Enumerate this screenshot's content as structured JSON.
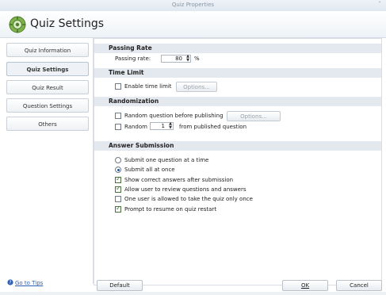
{
  "window": {
    "title": "Quiz Properties",
    "chevron": "˅"
  },
  "header": {
    "title": "Quiz Settings",
    "icon": "gear-settings-icon"
  },
  "sidebar": {
    "items": [
      {
        "label": "Quiz Information"
      },
      {
        "label": "Quiz Settings",
        "active": true
      },
      {
        "label": "Quiz Result"
      },
      {
        "label": "Question Settings"
      },
      {
        "label": "Others"
      }
    ],
    "tips_link": "Go to Tips"
  },
  "passing_rate": {
    "header": "Passing Rate",
    "label": "Passing rate:",
    "value": "80",
    "unit": "%"
  },
  "time_limit": {
    "header": "Time Limit",
    "enable_label": "Enable time limit",
    "enabled": false,
    "options_label": "Options..."
  },
  "randomization": {
    "header": "Randomization",
    "random_before_label": "Random question before publishing",
    "random_before_checked": false,
    "options_label": "Options...",
    "random_label": "Random",
    "random_count": "1",
    "random_suffix": "from published question",
    "random_checked": false
  },
  "answer_submission": {
    "header": "Answer Submission",
    "radios": [
      {
        "label": "Submit one question at a time",
        "selected": false
      },
      {
        "label": "Submit all at once",
        "selected": true
      }
    ],
    "checkboxes": [
      {
        "label": "Show correct answers after submission",
        "checked": true
      },
      {
        "label": "Allow user to review questions and answers",
        "checked": true
      },
      {
        "label": "One user is allowed to take the quiz only once",
        "checked": false
      },
      {
        "label": "Prompt to resume on quiz restart",
        "checked": true
      }
    ]
  },
  "footer": {
    "default_label": "Default",
    "ok_label": "OK",
    "cancel_label": "Cancel"
  },
  "colors": {
    "accent": "#2d5fb3",
    "section_bg": "#e4e9ef",
    "check": "#2e7d32"
  }
}
